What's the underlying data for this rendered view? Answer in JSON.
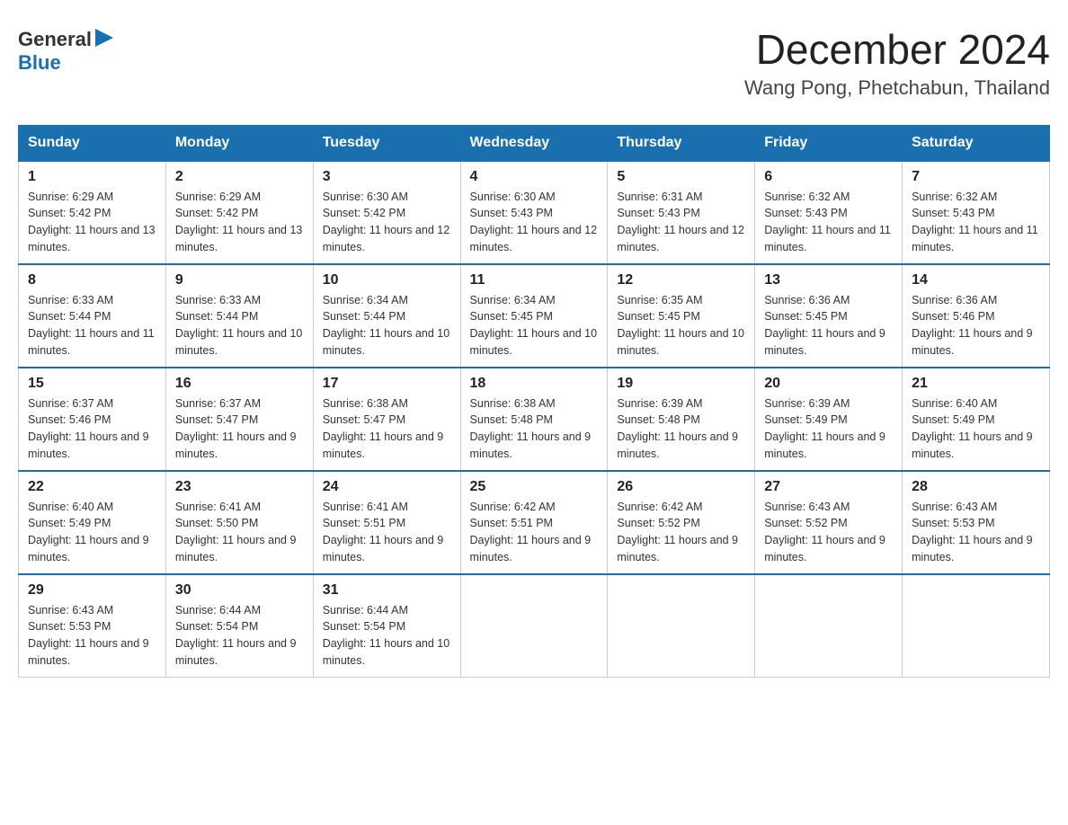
{
  "header": {
    "logo_general": "General",
    "logo_blue": "Blue",
    "month_title": "December 2024",
    "location": "Wang Pong, Phetchabun, Thailand"
  },
  "days_of_week": [
    "Sunday",
    "Monday",
    "Tuesday",
    "Wednesday",
    "Thursday",
    "Friday",
    "Saturday"
  ],
  "weeks": [
    [
      {
        "day": "1",
        "sunrise": "6:29 AM",
        "sunset": "5:42 PM",
        "daylight": "11 hours and 13 minutes."
      },
      {
        "day": "2",
        "sunrise": "6:29 AM",
        "sunset": "5:42 PM",
        "daylight": "11 hours and 13 minutes."
      },
      {
        "day": "3",
        "sunrise": "6:30 AM",
        "sunset": "5:42 PM",
        "daylight": "11 hours and 12 minutes."
      },
      {
        "day": "4",
        "sunrise": "6:30 AM",
        "sunset": "5:43 PM",
        "daylight": "11 hours and 12 minutes."
      },
      {
        "day": "5",
        "sunrise": "6:31 AM",
        "sunset": "5:43 PM",
        "daylight": "11 hours and 12 minutes."
      },
      {
        "day": "6",
        "sunrise": "6:32 AM",
        "sunset": "5:43 PM",
        "daylight": "11 hours and 11 minutes."
      },
      {
        "day": "7",
        "sunrise": "6:32 AM",
        "sunset": "5:43 PM",
        "daylight": "11 hours and 11 minutes."
      }
    ],
    [
      {
        "day": "8",
        "sunrise": "6:33 AM",
        "sunset": "5:44 PM",
        "daylight": "11 hours and 11 minutes."
      },
      {
        "day": "9",
        "sunrise": "6:33 AM",
        "sunset": "5:44 PM",
        "daylight": "11 hours and 10 minutes."
      },
      {
        "day": "10",
        "sunrise": "6:34 AM",
        "sunset": "5:44 PM",
        "daylight": "11 hours and 10 minutes."
      },
      {
        "day": "11",
        "sunrise": "6:34 AM",
        "sunset": "5:45 PM",
        "daylight": "11 hours and 10 minutes."
      },
      {
        "day": "12",
        "sunrise": "6:35 AM",
        "sunset": "5:45 PM",
        "daylight": "11 hours and 10 minutes."
      },
      {
        "day": "13",
        "sunrise": "6:36 AM",
        "sunset": "5:45 PM",
        "daylight": "11 hours and 9 minutes."
      },
      {
        "day": "14",
        "sunrise": "6:36 AM",
        "sunset": "5:46 PM",
        "daylight": "11 hours and 9 minutes."
      }
    ],
    [
      {
        "day": "15",
        "sunrise": "6:37 AM",
        "sunset": "5:46 PM",
        "daylight": "11 hours and 9 minutes."
      },
      {
        "day": "16",
        "sunrise": "6:37 AM",
        "sunset": "5:47 PM",
        "daylight": "11 hours and 9 minutes."
      },
      {
        "day": "17",
        "sunrise": "6:38 AM",
        "sunset": "5:47 PM",
        "daylight": "11 hours and 9 minutes."
      },
      {
        "day": "18",
        "sunrise": "6:38 AM",
        "sunset": "5:48 PM",
        "daylight": "11 hours and 9 minutes."
      },
      {
        "day": "19",
        "sunrise": "6:39 AM",
        "sunset": "5:48 PM",
        "daylight": "11 hours and 9 minutes."
      },
      {
        "day": "20",
        "sunrise": "6:39 AM",
        "sunset": "5:49 PM",
        "daylight": "11 hours and 9 minutes."
      },
      {
        "day": "21",
        "sunrise": "6:40 AM",
        "sunset": "5:49 PM",
        "daylight": "11 hours and 9 minutes."
      }
    ],
    [
      {
        "day": "22",
        "sunrise": "6:40 AM",
        "sunset": "5:49 PM",
        "daylight": "11 hours and 9 minutes."
      },
      {
        "day": "23",
        "sunrise": "6:41 AM",
        "sunset": "5:50 PM",
        "daylight": "11 hours and 9 minutes."
      },
      {
        "day": "24",
        "sunrise": "6:41 AM",
        "sunset": "5:51 PM",
        "daylight": "11 hours and 9 minutes."
      },
      {
        "day": "25",
        "sunrise": "6:42 AM",
        "sunset": "5:51 PM",
        "daylight": "11 hours and 9 minutes."
      },
      {
        "day": "26",
        "sunrise": "6:42 AM",
        "sunset": "5:52 PM",
        "daylight": "11 hours and 9 minutes."
      },
      {
        "day": "27",
        "sunrise": "6:43 AM",
        "sunset": "5:52 PM",
        "daylight": "11 hours and 9 minutes."
      },
      {
        "day": "28",
        "sunrise": "6:43 AM",
        "sunset": "5:53 PM",
        "daylight": "11 hours and 9 minutes."
      }
    ],
    [
      {
        "day": "29",
        "sunrise": "6:43 AM",
        "sunset": "5:53 PM",
        "daylight": "11 hours and 9 minutes."
      },
      {
        "day": "30",
        "sunrise": "6:44 AM",
        "sunset": "5:54 PM",
        "daylight": "11 hours and 9 minutes."
      },
      {
        "day": "31",
        "sunrise": "6:44 AM",
        "sunset": "5:54 PM",
        "daylight": "11 hours and 10 minutes."
      },
      null,
      null,
      null,
      null
    ]
  ]
}
